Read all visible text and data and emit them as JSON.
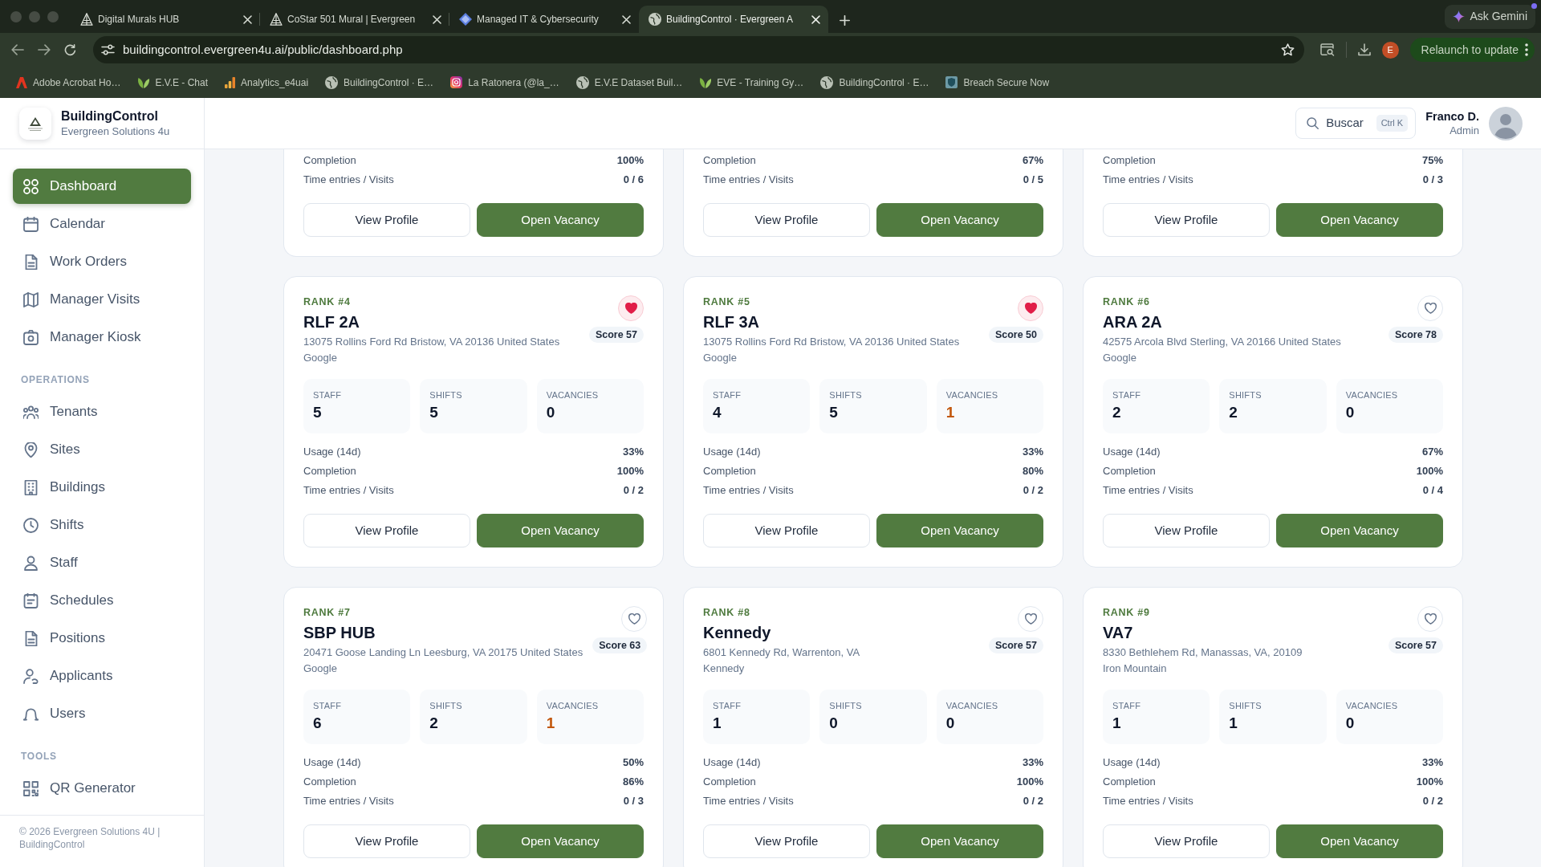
{
  "browser": {
    "tabs": [
      {
        "title": "Digital Murals HUB",
        "selected": false
      },
      {
        "title": "CoStar 501 Mural | Evergreen",
        "selected": false
      },
      {
        "title": "Managed IT & Cybersecurity",
        "selected": false
      },
      {
        "title": "BuildingControl · Evergreen A",
        "selected": true
      }
    ],
    "ask_button": "Ask Gemini",
    "url": "buildingcontrol.evergreen4u.ai/public/dashboard.php",
    "profile_initial": "E",
    "relaunch_button": "Relaunch to update",
    "bookmarks": [
      "Adobe Acrobat Ho…",
      "E.V.E - Chat",
      "Analytics_e4uai",
      "BuildingControl · E…",
      "La Ratonera (@la_…",
      "E.V.E Dataset Buil…",
      "EVE - Training Gy…",
      "BuildingControl · E…",
      "Breach Secure Now"
    ]
  },
  "sidebar": {
    "brand": {
      "title": "BuildingControl",
      "subtitle": "Evergreen Solutions 4u"
    },
    "sections": [
      {
        "items": [
          {
            "label": "Dashboard",
            "selected": true
          },
          {
            "label": "Calendar",
            "selected": false
          },
          {
            "label": "Work Orders",
            "selected": false
          },
          {
            "label": "Manager Visits",
            "selected": false
          },
          {
            "label": "Manager Kiosk",
            "selected": false
          }
        ]
      },
      {
        "heading": "OPERATIONS",
        "items": [
          {
            "label": "Tenants",
            "selected": false
          },
          {
            "label": "Sites",
            "selected": false
          },
          {
            "label": "Buildings",
            "selected": false
          },
          {
            "label": "Shifts",
            "selected": false
          },
          {
            "label": "Staff",
            "selected": false
          },
          {
            "label": "Schedules",
            "selected": false
          },
          {
            "label": "Positions",
            "selected": false
          },
          {
            "label": "Applicants",
            "selected": false
          },
          {
            "label": "Users",
            "selected": false
          }
        ]
      },
      {
        "heading": "TOOLS",
        "items": [
          {
            "label": "QR Generator",
            "selected": false
          }
        ]
      }
    ],
    "footer": "© 2026 Evergreen Solutions 4U | BuildingControl"
  },
  "header": {
    "search": {
      "label": "Buscar",
      "shortcut": "Ctrl K"
    },
    "user": {
      "name": "Franco D.",
      "role": "Admin"
    }
  },
  "cards": [
    {
      "kind": "partial",
      "metrics": [
        {
          "label": "Completion",
          "value": "100%"
        },
        {
          "label": "Time entries / Visits",
          "value": "0 / 6"
        }
      ],
      "buttons": [
        {
          "label": "View Profile",
          "kind": "outline"
        },
        {
          "label": "Open Vacancy",
          "kind": "primary"
        }
      ]
    },
    {
      "kind": "partial",
      "metrics": [
        {
          "label": "Completion",
          "value": "67%"
        },
        {
          "label": "Time entries / Visits",
          "value": "0 / 5"
        }
      ],
      "buttons": [
        {
          "label": "View Profile",
          "kind": "outline"
        },
        {
          "label": "Open Vacancy",
          "kind": "primary"
        }
      ]
    },
    {
      "kind": "partial",
      "metrics": [
        {
          "label": "Completion",
          "value": "75%"
        },
        {
          "label": "Time entries / Visits",
          "value": "0 / 3"
        }
      ],
      "buttons": [
        {
          "label": "View Profile",
          "kind": "outline"
        },
        {
          "label": "Open Vacancy",
          "kind": "primary"
        }
      ]
    },
    {
      "kind": "full",
      "rank": "RANK #4",
      "name": "RLF 2A",
      "address": "13075 Rollins Ford Rd Bristow, VA 20136 United States",
      "company": "Google",
      "favorite": true,
      "score": "Score 57",
      "stats": [
        {
          "label": "STAFF",
          "value": "5",
          "warning": false
        },
        {
          "label": "SHIFTS",
          "value": "5",
          "warning": false
        },
        {
          "label": "VACANCIES",
          "value": "0",
          "warning": false
        }
      ],
      "metrics": [
        {
          "label": "Usage (14d)",
          "value": "33%"
        },
        {
          "label": "Completion",
          "value": "100%"
        },
        {
          "label": "Time entries / Visits",
          "value": "0 / 2"
        }
      ],
      "buttons": [
        {
          "label": "View Profile",
          "kind": "outline"
        },
        {
          "label": "Open Vacancy",
          "kind": "primary"
        }
      ]
    },
    {
      "kind": "full",
      "rank": "RANK #5",
      "name": "RLF 3A",
      "address": "13075 Rollins Ford Rd Bristow, VA 20136 United States",
      "company": "Google",
      "favorite": true,
      "score": "Score 50",
      "stats": [
        {
          "label": "STAFF",
          "value": "4",
          "warning": false
        },
        {
          "label": "SHIFTS",
          "value": "5",
          "warning": false
        },
        {
          "label": "VACANCIES",
          "value": "1",
          "warning": true
        }
      ],
      "metrics": [
        {
          "label": "Usage (14d)",
          "value": "33%"
        },
        {
          "label": "Completion",
          "value": "80%"
        },
        {
          "label": "Time entries / Visits",
          "value": "0 / 2"
        }
      ],
      "buttons": [
        {
          "label": "View Profile",
          "kind": "outline"
        },
        {
          "label": "Open Vacancy",
          "kind": "primary"
        }
      ]
    },
    {
      "kind": "full",
      "rank": "RANK #6",
      "name": "ARA 2A",
      "address": "42575 Arcola Blvd Sterling, VA 20166 United States",
      "company": "Google",
      "favorite": false,
      "score": "Score 78",
      "stats": [
        {
          "label": "STAFF",
          "value": "2",
          "warning": false
        },
        {
          "label": "SHIFTS",
          "value": "2",
          "warning": false
        },
        {
          "label": "VACANCIES",
          "value": "0",
          "warning": false
        }
      ],
      "metrics": [
        {
          "label": "Usage (14d)",
          "value": "67%"
        },
        {
          "label": "Completion",
          "value": "100%"
        },
        {
          "label": "Time entries / Visits",
          "value": "0 / 4"
        }
      ],
      "buttons": [
        {
          "label": "View Profile",
          "kind": "outline"
        },
        {
          "label": "Open Vacancy",
          "kind": "primary"
        }
      ]
    },
    {
      "kind": "full",
      "rank": "RANK #7",
      "name": "SBP HUB",
      "address": "20471 Goose Landing Ln Leesburg, VA 20175 United States",
      "company": "Google",
      "favorite": false,
      "score": "Score 63",
      "stats": [
        {
          "label": "STAFF",
          "value": "6",
          "warning": false
        },
        {
          "label": "SHIFTS",
          "value": "2",
          "warning": false
        },
        {
          "label": "VACANCIES",
          "value": "1",
          "warning": true
        }
      ],
      "metrics": [
        {
          "label": "Usage (14d)",
          "value": "50%"
        },
        {
          "label": "Completion",
          "value": "86%"
        },
        {
          "label": "Time entries / Visits",
          "value": "0 / 3"
        }
      ],
      "buttons": [
        {
          "label": "View Profile",
          "kind": "outline"
        },
        {
          "label": "Open Vacancy",
          "kind": "primary"
        }
      ]
    },
    {
      "kind": "full",
      "rank": "RANK #8",
      "name": "Kennedy",
      "address": "6801 Kennedy Rd, Warrenton, VA",
      "company": "Kennedy",
      "favorite": false,
      "score": "Score 57",
      "stats": [
        {
          "label": "STAFF",
          "value": "1",
          "warning": false
        },
        {
          "label": "SHIFTS",
          "value": "0",
          "warning": false
        },
        {
          "label": "VACANCIES",
          "value": "0",
          "warning": false
        }
      ],
      "metrics": [
        {
          "label": "Usage (14d)",
          "value": "33%"
        },
        {
          "label": "Completion",
          "value": "100%"
        },
        {
          "label": "Time entries / Visits",
          "value": "0 / 2"
        }
      ],
      "buttons": [
        {
          "label": "View Profile",
          "kind": "outline"
        },
        {
          "label": "Open Vacancy",
          "kind": "primary"
        }
      ]
    },
    {
      "kind": "full",
      "rank": "RANK #9",
      "name": "VA7",
      "address": "8330 Bethlehem Rd, Manassas, VA, 20109",
      "company": "Iron Mountain",
      "favorite": false,
      "score": "Score 57",
      "stats": [
        {
          "label": "STAFF",
          "value": "1",
          "warning": false
        },
        {
          "label": "SHIFTS",
          "value": "1",
          "warning": false
        },
        {
          "label": "VACANCIES",
          "value": "0",
          "warning": false
        }
      ],
      "metrics": [
        {
          "label": "Usage (14d)",
          "value": "33%"
        },
        {
          "label": "Completion",
          "value": "100%"
        },
        {
          "label": "Time entries / Visits",
          "value": "0 / 2"
        }
      ],
      "buttons": [
        {
          "label": "View Profile",
          "kind": "outline"
        },
        {
          "label": "Open Vacancy",
          "kind": "primary"
        }
      ]
    }
  ]
}
